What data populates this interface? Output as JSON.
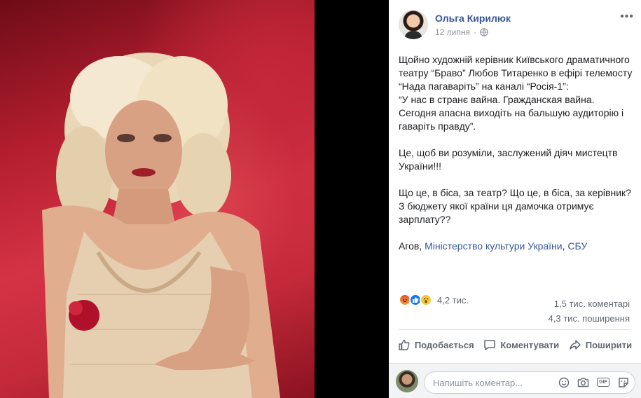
{
  "post": {
    "author": "Ольга Кирилюк",
    "date": "12 липня",
    "separator": "·",
    "paragraphs": {
      "p1": "Щойно художній керівник Київського драматичного театру “Браво” Любов Титаренко в ефірі телемосту “Нада пагаваріть” на каналі “Росія-1”:",
      "p1b": "“У нас в странє вайна. Гражданская вайна. Сегодня апасна виходіть на бальшую аудиторію і гаваріть правду”.",
      "p2": "Це, щоб ви розуміли, заслужений діяч мистецтв України!!!",
      "p3": "Що це, в біса, за театр? Що це, в біса, за керівник?",
      "p3b": "З бюджету якої країни ця дамочка отримує зарплату??",
      "p4_prefix": "Агов, ",
      "p4_link1": "Міністерство культури України",
      "p4_sep": ", ",
      "p4_link2": "СБУ"
    }
  },
  "reactions": {
    "icons": [
      "angry-icon",
      "like-icon",
      "wow-icon"
    ],
    "count": "4,2 тис.",
    "comments": "1,5 тис. коментарі",
    "shares": "4,3 тис. поширення"
  },
  "actions": {
    "like": "Подобається",
    "comment": "Коментувати",
    "share": "Поширити"
  },
  "comment_bar": {
    "placeholder": "Напишіть коментар...",
    "icons": [
      "emoji-icon",
      "camera-icon",
      "gif-icon",
      "sticker-icon"
    ],
    "gif_label": "GIF"
  },
  "colors": {
    "link": "#385898",
    "text": "#1c1e21",
    "secondary": "#606770",
    "backdrop_red": "#c42a3a"
  }
}
